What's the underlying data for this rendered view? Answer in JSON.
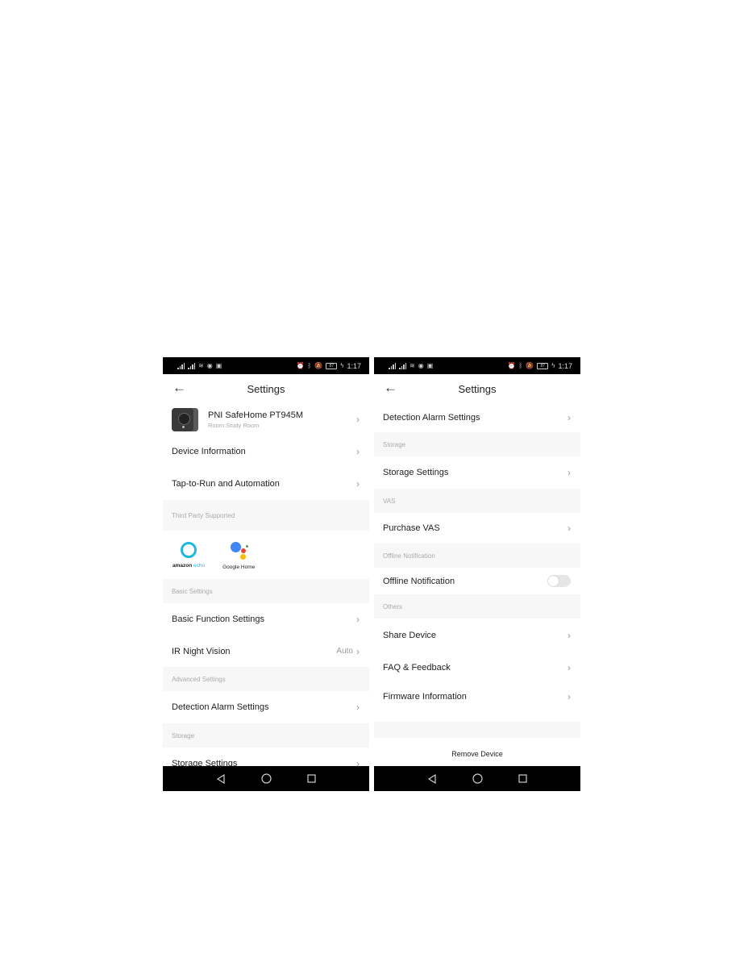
{
  "status_bar": {
    "time": "1:17",
    "battery": "87"
  },
  "left_screen": {
    "title": "Settings",
    "device": {
      "name": "PNI SafeHome PT945M",
      "room": "Room:Study Room"
    },
    "rows_top": [
      {
        "label": "Device Information"
      },
      {
        "label": "Tap-to-Run and Automation"
      }
    ],
    "third_party": {
      "section": "Third Party Supported",
      "amazon_brand": "amazon",
      "amazon_product": "echo",
      "google_brand": "Google",
      "google_product": "Home"
    },
    "basic": {
      "section": "Basic Settings",
      "function_label": "Basic Function Settings",
      "ir_label": "IR Night Vision",
      "ir_value": "Auto"
    },
    "advanced": {
      "section": "Advanced Settings",
      "detection_label": "Detection Alarm Settings"
    },
    "storage": {
      "section": "Storage",
      "label": "Storage Settings"
    }
  },
  "right_screen": {
    "title": "Settings",
    "detection_label": "Detection Alarm Settings",
    "storage": {
      "section": "Storage",
      "label": "Storage Settings"
    },
    "vas": {
      "section": "VAS",
      "label": "Purchase VAS"
    },
    "offline": {
      "section": "Offline Notification",
      "label": "Offline Notification",
      "enabled": false
    },
    "others": {
      "section": "Others",
      "items": [
        {
          "label": "Share Device"
        },
        {
          "label": "FAQ & Feedback"
        },
        {
          "label": "Firmware Information"
        }
      ]
    },
    "remove_label": "Remove Device"
  },
  "icons": {
    "chevron": "›",
    "back": "←"
  }
}
